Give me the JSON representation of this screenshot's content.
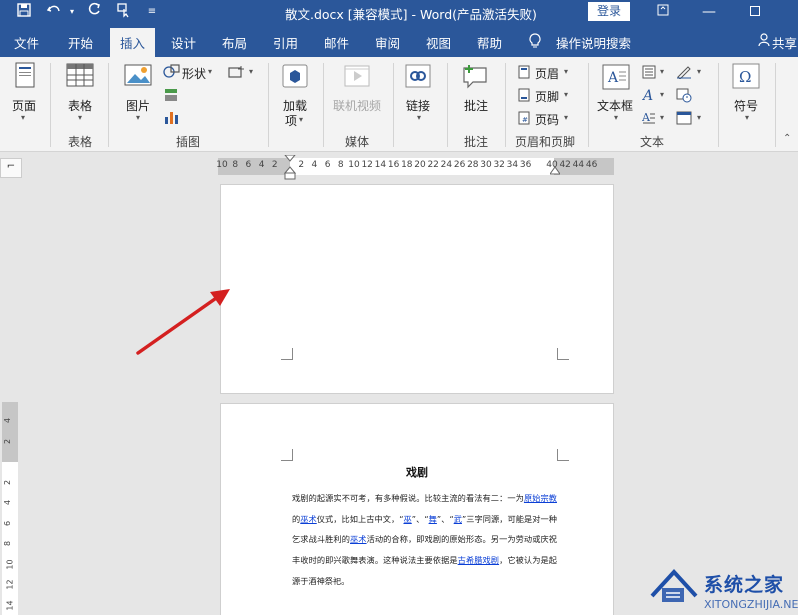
{
  "titlebar": {
    "doc_title": "散文.docx [兼容模式] - Word(产品激活失败)",
    "login_label": "登录"
  },
  "tabs": [
    {
      "label": "文件"
    },
    {
      "label": "开始"
    },
    {
      "label": "插入"
    },
    {
      "label": "设计"
    },
    {
      "label": "布局"
    },
    {
      "label": "引用"
    },
    {
      "label": "邮件"
    },
    {
      "label": "审阅"
    },
    {
      "label": "视图"
    },
    {
      "label": "帮助"
    },
    {
      "label": "操作说明搜索"
    },
    {
      "label": "共享"
    }
  ],
  "ribbon": {
    "page_btn": "页面",
    "table_btn": "表格",
    "table_group": "表格",
    "picture_btn": "图片",
    "shapes_btn": "形状",
    "illustrations_group": "插图",
    "addins_btn_line1": "加载",
    "addins_btn_line2": "项",
    "online_video_btn": "联机视频",
    "media_group": "媒体",
    "link_btn": "链接",
    "comment_btn": "批注",
    "comment_group": "批注",
    "header_btn": "页眉",
    "footer_btn": "页脚",
    "pagenum_btn": "页码",
    "hf_group": "页眉和页脚",
    "textbox_btn": "文本框",
    "text_group": "文本",
    "symbol_btn": "符号"
  },
  "ruler": {
    "numbers": [
      "10",
      "8",
      "6",
      "4",
      "2",
      "",
      "2",
      "4",
      "6",
      "8",
      "10",
      "12",
      "14",
      "16",
      "18",
      "20",
      "22",
      "24",
      "26",
      "28",
      "30",
      "32",
      "34",
      "36",
      "",
      "40",
      "42",
      "44",
      "46"
    ]
  },
  "vruler": {
    "numbers": [
      "4",
      "2",
      "",
      "2",
      "4",
      "6",
      "8",
      "10",
      "12",
      "14"
    ]
  },
  "document": {
    "heading": "戏剧",
    "para_1": "戏剧的起源实不可考，有多种假说。比较主流的看法有二：一为",
    "link_1": "原始宗教",
    "text_2": "的",
    "link_2": "巫术",
    "text_3": "仪式，比如上古中文，“",
    "link_3": "巫",
    "text_4": "”、“",
    "link_4": "舞",
    "text_5": "”、“",
    "link_5": "武",
    "text_6": "”三字同源，可能是对一种乞求战斗胜利的",
    "link_6": "巫术",
    "text_7": "活动的合称，即戏剧的原始形态。另一为劳动或庆祝丰收时的即兴歌舞表演。这种说法主要依据是",
    "link_7": "古希腊戏剧",
    "text_8": "，它被认为是起源于酒神祭祀。"
  },
  "watermark": {
    "brand": "系统之家",
    "url": "XITONGZHIJIA.NET"
  },
  "colors": {
    "titlebar": "#2b579a",
    "arrow": "#d42020",
    "link": "#0b3fd6"
  }
}
